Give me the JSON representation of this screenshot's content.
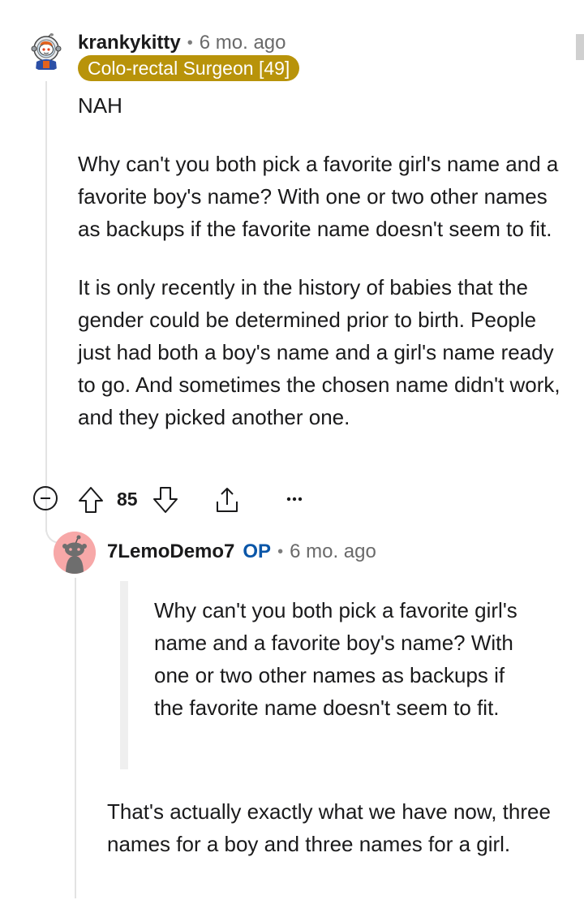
{
  "comment": {
    "username": "krankykitty",
    "separator": "•",
    "time": "6 mo. ago",
    "flair": "Colo-rectal Surgeon [49]",
    "paragraphs": [
      "NAH",
      "Why can't you both pick a favorite girl's name and a favorite boy's name? With one or two other names as backups if the favorite name doesn't seem to fit.",
      "It is only recently in the history of babies that the gender could be determined prior to birth. People just had both a boy's name and a girl's name ready to go. And sometimes the chosen name didn't work, and they picked another one."
    ],
    "actions": {
      "score": "85",
      "collapse_icon": "collapse-minus-icon",
      "upvote_icon": "upvote-arrow-icon",
      "downvote_icon": "downvote-arrow-icon",
      "share_icon": "share-icon",
      "more_icon": "more-dots-icon"
    }
  },
  "reply": {
    "username": "7LemoDemo7",
    "op_badge": "OP",
    "separator": "•",
    "time": "6 mo. ago",
    "quote": "Why can't you both pick a favorite girl's name and a favorite boy's name? With one or two other names as backups if the favorite name doesn't seem to fit.",
    "text": "That's actually exactly what we have now, three names for a boy and three names for a girl."
  },
  "colors": {
    "flair_bg": "#b8930a",
    "op_blue": "#0a56a8",
    "avatar2_bg": "#f7a8a8",
    "thread_line": "#e3e3e3"
  }
}
